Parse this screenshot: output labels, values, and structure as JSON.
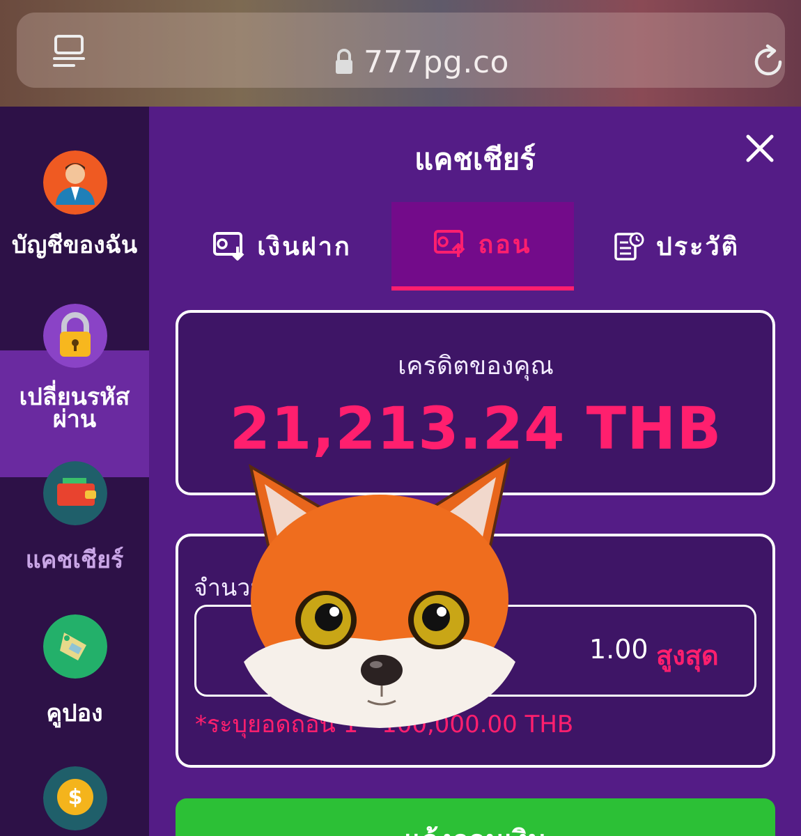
{
  "browser": {
    "url": "777pg.co",
    "icons": [
      "tabs-icon",
      "lock-icon",
      "reload-icon"
    ]
  },
  "sidebar": {
    "items": [
      {
        "label": "บัญชีของฉัน",
        "icon": "user-avatar-icon"
      },
      {
        "label": "เปลี่ยนรหัสผ่าน",
        "icon": "padlock-icon"
      },
      {
        "label": "แคชเชียร์",
        "icon": "wallet-icon",
        "active": true
      },
      {
        "label": "คูปอง",
        "icon": "coupon-tag-icon"
      },
      {
        "label": "",
        "icon": "coin-icon"
      }
    ]
  },
  "panel": {
    "title": "แคชเชียร์",
    "tabs": [
      {
        "label": "เงินฝาก",
        "icon": "deposit-icon"
      },
      {
        "label": "ถอน",
        "icon": "withdraw-icon",
        "active": true
      },
      {
        "label": "ประวัติ",
        "icon": "history-icon"
      }
    ],
    "credit": {
      "label": "เครดิตของคุณ",
      "value": "21,213.24 THB"
    },
    "withdraw": {
      "amount_label": "จำนวน",
      "amount_value": "1.00",
      "max_label": "สูงสุด",
      "hint": "*ระบุยอดถอน 1 - 100,000.00 THB"
    },
    "confirm_label": "แจ้งถอนเงิน"
  },
  "colors": {
    "accent": "#ff1f6e",
    "panel_bg": "#541c86",
    "sidebar_bg": "#2d1147",
    "button_green": "#2cc036"
  }
}
